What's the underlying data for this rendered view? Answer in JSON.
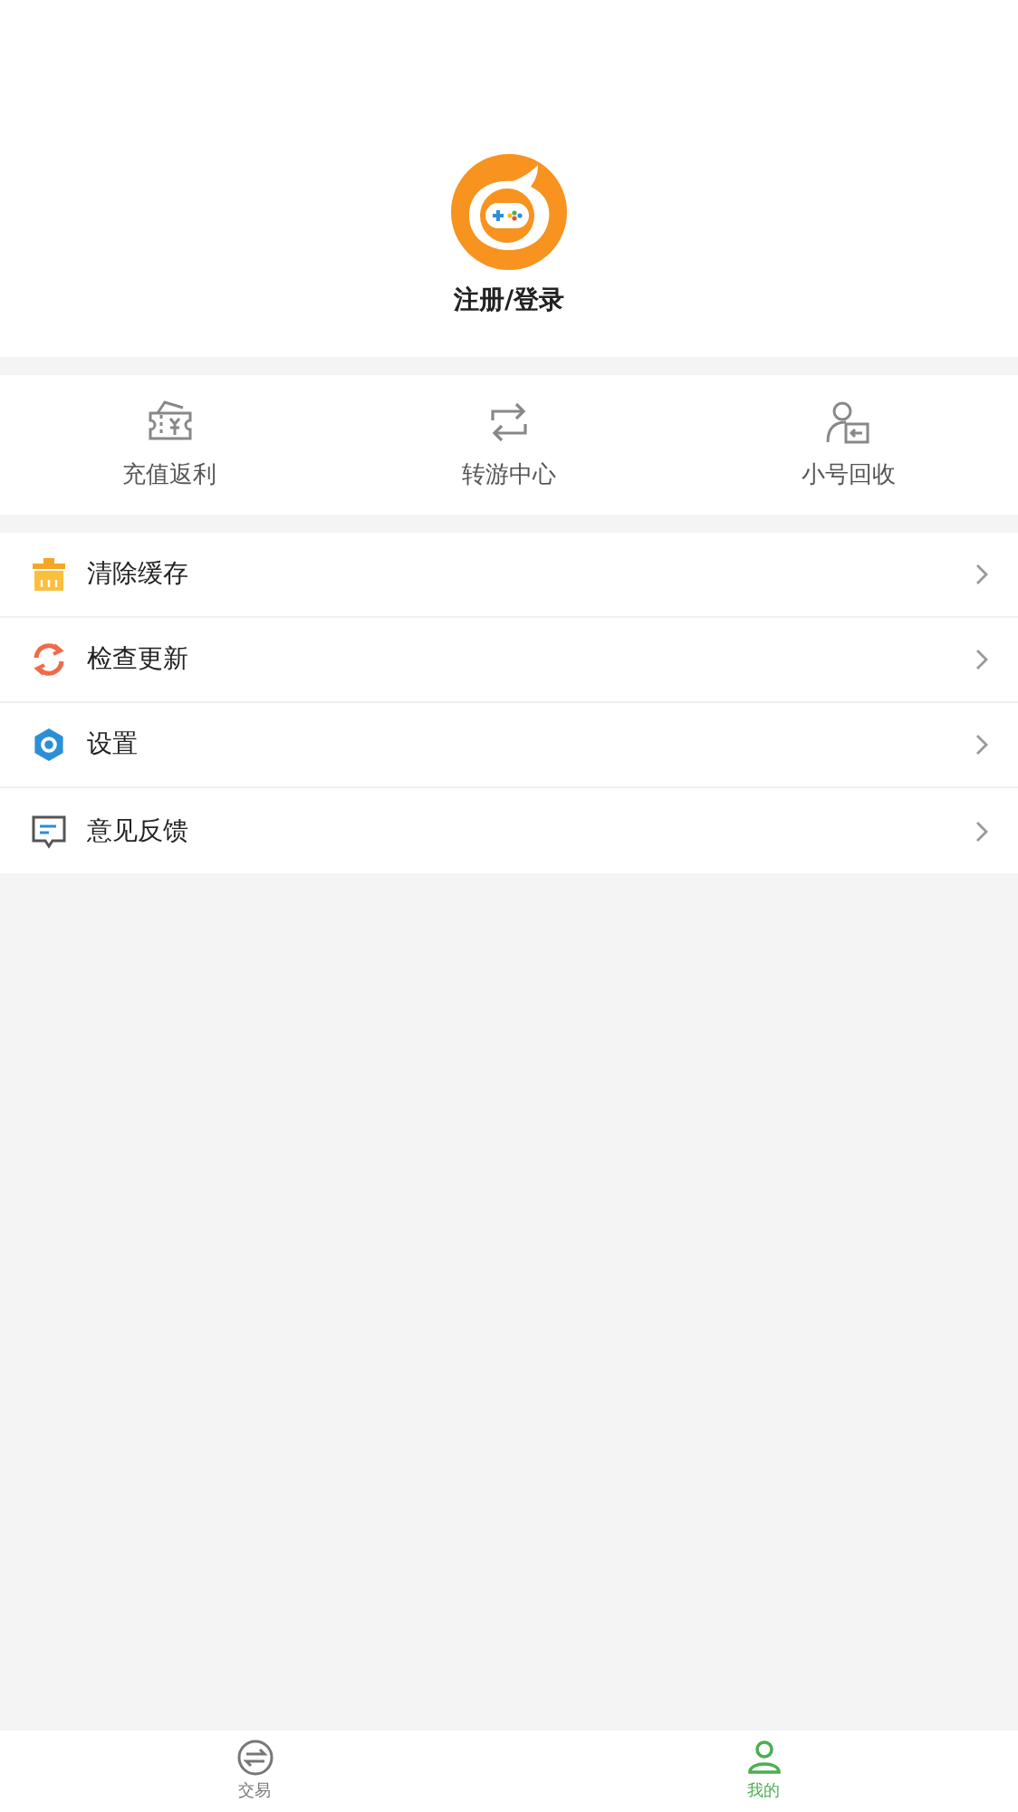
{
  "profile": {
    "login_label": "注册/登录"
  },
  "quick_actions": [
    {
      "kind": "ticket",
      "label": "充值返利"
    },
    {
      "kind": "transfer",
      "label": "转游中心"
    },
    {
      "kind": "account",
      "label": "小号回收"
    }
  ],
  "menu": [
    {
      "kind": "clear",
      "label": "清除缓存"
    },
    {
      "kind": "update",
      "label": "检查更新"
    },
    {
      "kind": "settings",
      "label": "设置"
    },
    {
      "kind": "feedback",
      "label": "意见反馈"
    }
  ],
  "tab_bar": [
    {
      "kind": "trade",
      "label": "交易",
      "selected": false
    },
    {
      "kind": "me",
      "label": "我的",
      "selected": true
    }
  ]
}
